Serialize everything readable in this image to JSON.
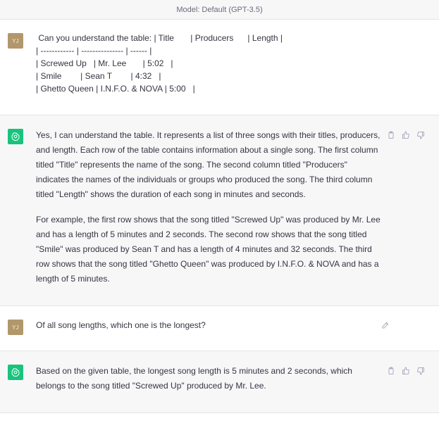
{
  "header": {
    "model_label": "Model: Default (GPT-3.5)"
  },
  "conversation": [
    {
      "role": "user",
      "avatar_initials": "YJ",
      "lines": [
        " Can you understand the table: | Title       | Producers      | Length |",
        "| ------------ | --------------- | ------ |",
        "| Screwed Up   | Mr. Lee       | 5:02   |",
        "| Smile        | Sean T        | 4:32   |",
        "| Ghetto Queen | I.N.F.O. & NOVA | 5:00   |"
      ]
    },
    {
      "role": "assistant",
      "paragraphs": [
        "Yes, I can understand the table. It represents a list of three songs with their titles, producers, and length. Each row of the table contains information about a single song. The first column titled \"Title\" represents the name of the song. The second column titled \"Producers\" indicates the names of the individuals or groups who produced the song. The third column titled \"Length\" shows the duration of each song in minutes and seconds.",
        "For example, the first row shows that the song titled \"Screwed Up\" was produced by Mr. Lee and has a length of 5 minutes and 2 seconds. The second row shows that the song titled \"Smile\" was produced by Sean T and has a length of 4 minutes and 32 seconds. The third row shows that the song titled \"Ghetto Queen\" was produced by I.N.F.O. & NOVA and has a length of 5 minutes."
      ]
    },
    {
      "role": "user",
      "avatar_initials": "YJ",
      "text": "Of all song lengths, which one is the longest?"
    },
    {
      "role": "assistant",
      "paragraphs": [
        "Based on the given table, the longest song length is 5 minutes and 2 seconds, which belongs to the song titled \"Screwed Up\" produced by Mr. Lee."
      ]
    }
  ],
  "icons": {
    "copy": "clipboard-icon",
    "thumbs_up": "thumbs-up-icon",
    "thumbs_down": "thumbs-down-icon",
    "edit": "edit-icon"
  },
  "colors": {
    "assistant_avatar": "#19c37d",
    "user_avatar": "#b1976b",
    "assistant_bg": "#f7f7f8",
    "icon_gray": "#acacbe"
  }
}
